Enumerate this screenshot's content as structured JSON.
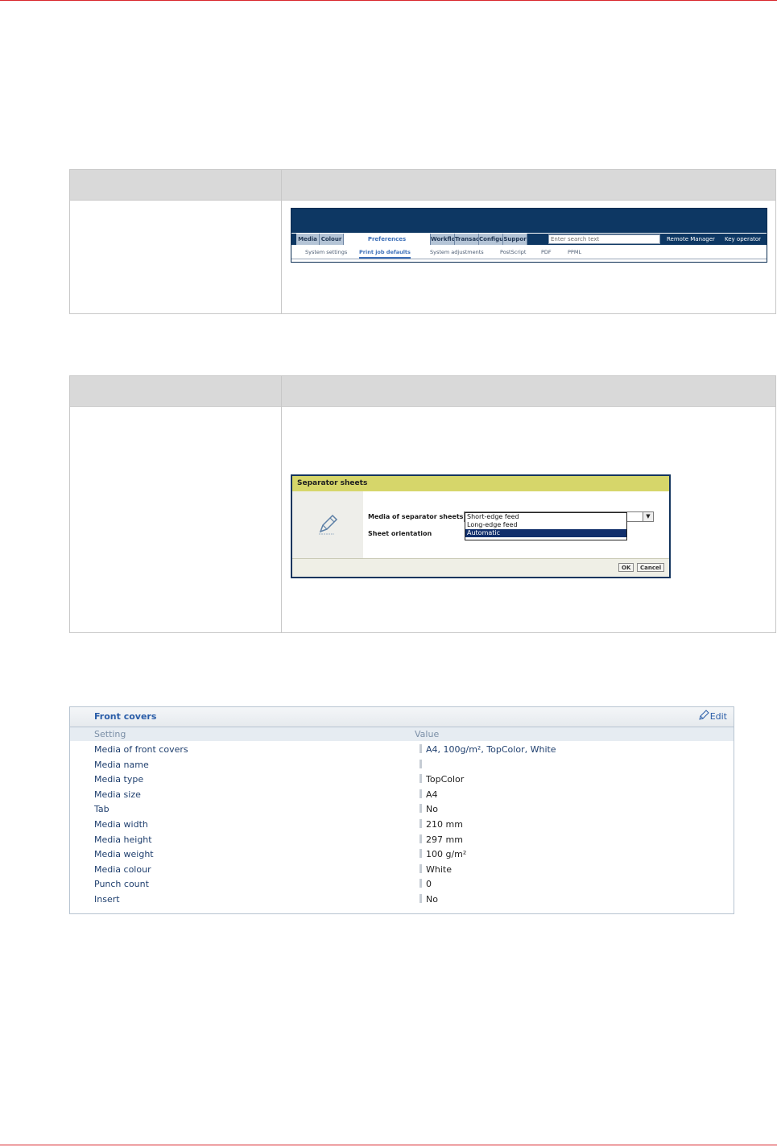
{
  "nav": {
    "tabs": [
      "Media",
      "Colour",
      "Preferences",
      "Workflo",
      "Transac",
      "Configu",
      "Suppor"
    ],
    "search_placeholder": "Enter search text",
    "links": [
      "Remote Manager",
      "Key operator"
    ],
    "subtabs": [
      "System settings",
      "Print job defaults",
      "System adjustments",
      "PostScript",
      "PDF",
      "PPML"
    ],
    "active_tab": "Preferences",
    "active_subtab": "Print job defaults"
  },
  "dialog": {
    "title": "Separator sheets",
    "field1_label": "Media of separator sheets",
    "field2_label": "Sheet orientation",
    "options": [
      "Short-edge feed",
      "Long-edge feed",
      "Automatic"
    ],
    "selected_option": "Automatic",
    "ok_label": "OK",
    "cancel_label": "Cancel"
  },
  "covers": {
    "title": "Front covers",
    "edit_label": "Edit",
    "col_setting": "Setting",
    "col_value": "Value",
    "rows": [
      {
        "setting": "Media of front covers",
        "value": "A4, 100g/m², TopColor, White"
      },
      {
        "setting": "Media name",
        "value": ""
      },
      {
        "setting": "Media type",
        "value": "TopColor"
      },
      {
        "setting": "Media size",
        "value": "A4"
      },
      {
        "setting": "Tab",
        "value": "No"
      },
      {
        "setting": "Media width",
        "value": "210 mm"
      },
      {
        "setting": "Media height",
        "value": "297 mm"
      },
      {
        "setting": "Media weight",
        "value": "100 g/m²"
      },
      {
        "setting": "Media colour",
        "value": "White"
      },
      {
        "setting": "Punch count",
        "value": "0"
      },
      {
        "setting": "Insert",
        "value": "No"
      }
    ]
  },
  "colors": {
    "accent_red": "#d9262c",
    "nav_blue": "#0d3763",
    "dialog_title_bg": "#d6d66a",
    "link_blue": "#2a5da8"
  }
}
